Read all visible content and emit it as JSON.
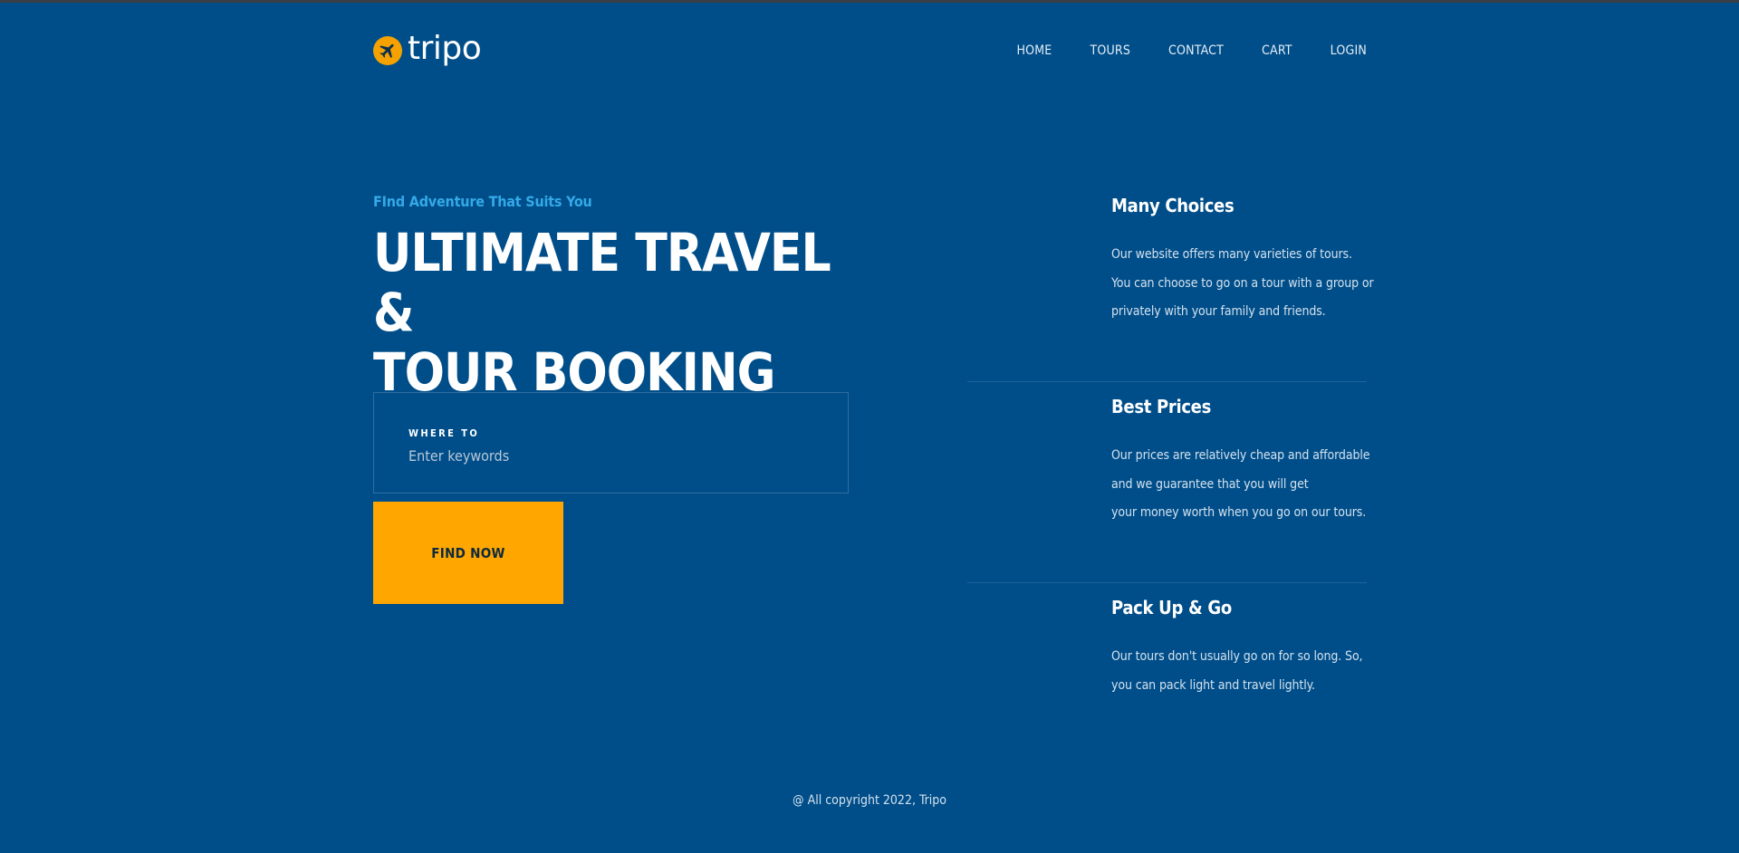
{
  "brand": {
    "name": "tripo",
    "logo_icon": "airplane-icon",
    "accent": "#f5a200"
  },
  "nav": {
    "items": [
      {
        "label": "HOME"
      },
      {
        "label": "TOURS"
      },
      {
        "label": "CONTACT"
      },
      {
        "label": "CART"
      },
      {
        "label": "LOGIN"
      }
    ]
  },
  "hero": {
    "eyebrow": "FInd Adventure That Suits You",
    "headline_line1": "ULTIMATE TRAVEL &",
    "headline_line2": "TOUR BOOKING"
  },
  "search": {
    "label": "WHERE TO",
    "placeholder": "Enter keywords",
    "value": "",
    "button_label": "FIND NOW"
  },
  "features": [
    {
      "title": "Many Choices",
      "line1": "Our website offers many varieties of tours.",
      "line2": "You can choose to go on a tour with a group or",
      "line3": "privately with your family and friends."
    },
    {
      "title": "Best Prices",
      "line1": "Our prices are relatively cheap and affordable",
      "line2": "and we guarantee that you will get",
      "line3": "your money worth when you go on our tours."
    },
    {
      "title": "Pack Up & Go",
      "line1": "Our tours don't usually go on for so long. So,",
      "line2": "you can pack light and travel lightly.",
      "line3": ""
    }
  ],
  "footer": {
    "copyright": "@ All copyright 2022, Tripo"
  },
  "colors": {
    "background": "#004e89",
    "button": "#ffa700",
    "eyebrow": "#34a9e8"
  }
}
